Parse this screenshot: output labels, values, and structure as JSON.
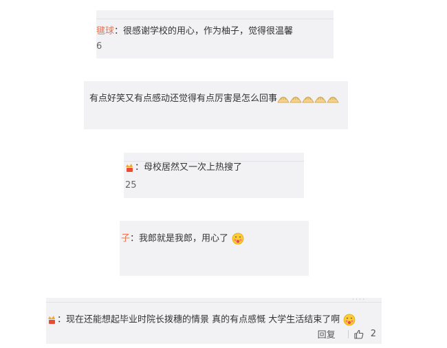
{
  "comments": [
    {
      "user": "毽球",
      "text": "很感谢学校的用心，作为柚子，觉得很温馨",
      "count": "6"
    },
    {
      "text": "有点好笑又有点感动还觉得有点厉害是怎么回事"
    },
    {
      "text": "母校居然又一次上热搜了",
      "count": "25"
    },
    {
      "user": "子",
      "text": "我郎就是我郎，用心了"
    },
    {
      "text": "现在还能想起毕业时院长拨穗的情景 真的有点感慨 大学生活结束了啊",
      "reply_label": "回复",
      "like_count": "2"
    }
  ],
  "icons": {
    "badge": "vip-badge-icon",
    "blush": "blush-emoji-icon",
    "dumpling": "dumpling-emoji-icon",
    "like": "thumbs-up-icon"
  },
  "colors": {
    "card_bg": "#f2f2f5",
    "username": "#eb7350",
    "text": "#333333"
  }
}
